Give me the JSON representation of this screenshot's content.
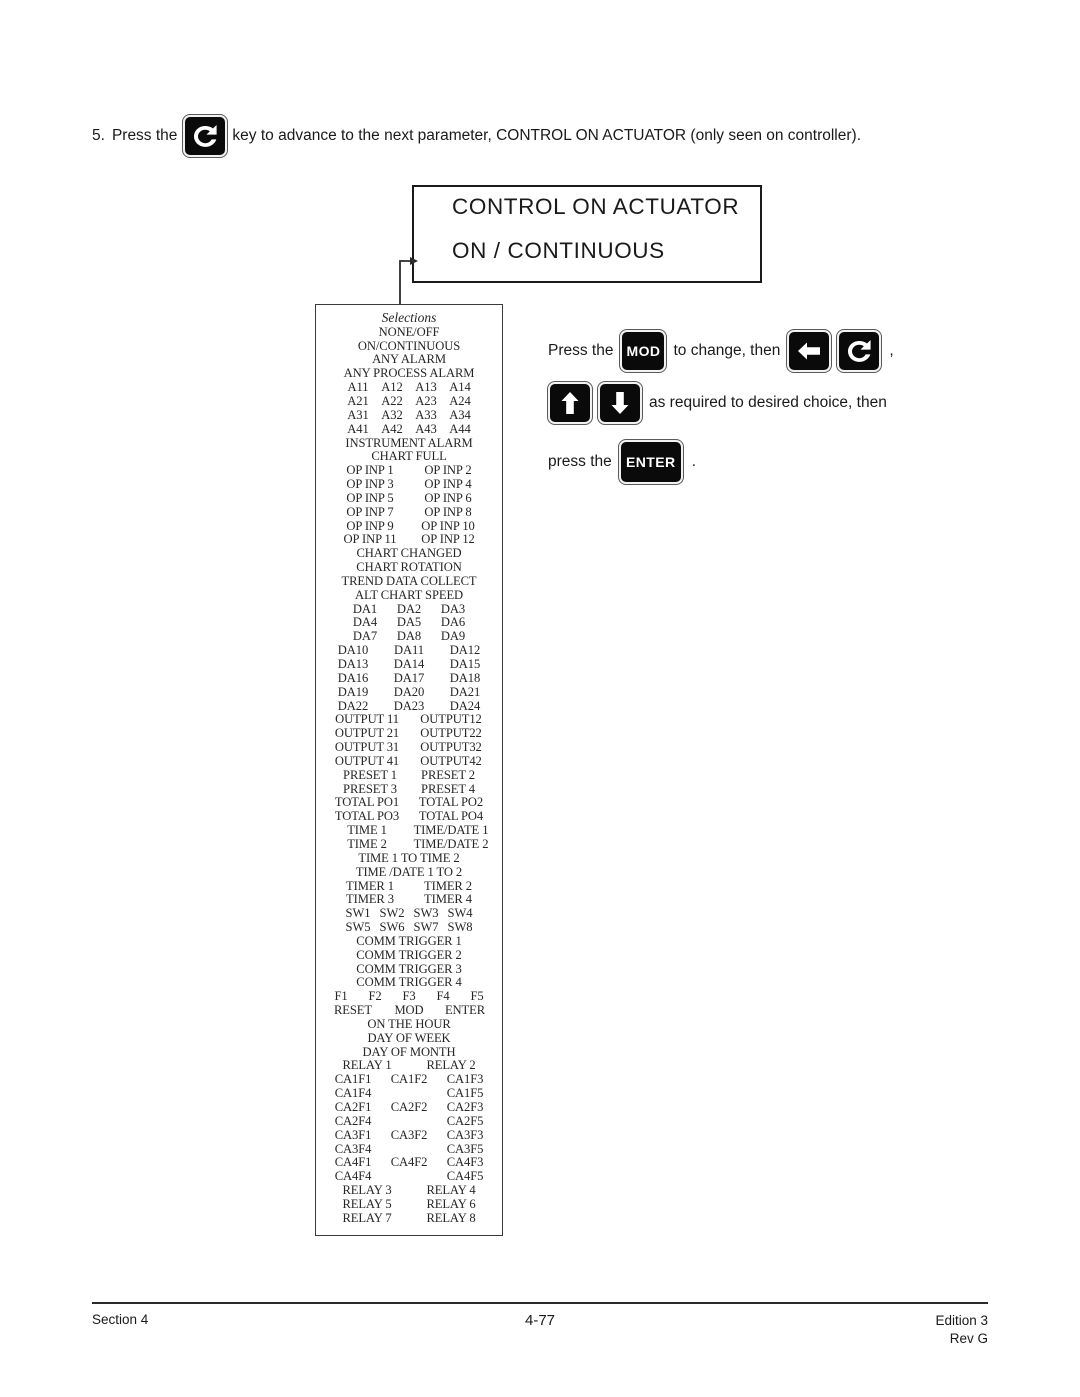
{
  "step": {
    "number": "5.",
    "text_before_key": "Press the",
    "key_icon": "loop-advance-icon",
    "text_after_key": "key to advance to the next parameter, CONTROL ON ACTUATOR  (only seen on controller)."
  },
  "display": {
    "line1": "CONTROL  ON  ACTUATOR",
    "line2": "ON / CONTINUOUS"
  },
  "instructions": {
    "row1": {
      "press_the": "Press the",
      "mod_key": "MOD",
      "to_change": "to change, then",
      "left_key_icon": "left-arrow-icon",
      "loop_key_icon": "loop-advance-icon",
      "comma": ","
    },
    "row2": {
      "up_key_icon": "up-arrow-icon",
      "down_key_icon": "down-arrow-icon",
      "text": "as required to desired choice, then"
    },
    "row3": {
      "press_the": "press  the",
      "enter_key": "ENTER",
      "period": "."
    }
  },
  "selections": {
    "title": "Selections",
    "rows": [
      {
        "cols": [
          "NONE/OFF"
        ]
      },
      {
        "cols": [
          "ON/CONTINUOUS"
        ]
      },
      {
        "cols": [
          "ANY ALARM"
        ]
      },
      {
        "cols": [
          "ANY PROCESS ALARM"
        ]
      },
      {
        "layout": "c4",
        "cols": [
          "A11",
          "A12",
          "A13",
          "A14"
        ]
      },
      {
        "layout": "c4",
        "cols": [
          "A21",
          "A22",
          "A23",
          "A24"
        ]
      },
      {
        "layout": "c4",
        "cols": [
          "A31",
          "A32",
          "A33",
          "A34"
        ]
      },
      {
        "layout": "c4",
        "cols": [
          "A41",
          "A42",
          "A43",
          "A44"
        ]
      },
      {
        "cols": [
          "INSTRUMENT ALARM"
        ]
      },
      {
        "cols": [
          "CHART FULL"
        ]
      },
      {
        "layout": "c2",
        "cols": [
          "OP INP 1",
          "OP INP 2"
        ]
      },
      {
        "layout": "c2",
        "cols": [
          "OP INP 3",
          "OP INP 4"
        ]
      },
      {
        "layout": "c2",
        "cols": [
          "OP INP 5",
          "OP INP 6"
        ]
      },
      {
        "layout": "c2",
        "cols": [
          "OP INP 7",
          "OP INP 8"
        ]
      },
      {
        "layout": "c2",
        "cols": [
          "OP INP 9",
          "OP INP 10"
        ]
      },
      {
        "layout": "c2",
        "cols": [
          "OP INP 11",
          "OP INP 12"
        ]
      },
      {
        "cols": [
          "CHART CHANGED"
        ]
      },
      {
        "cols": [
          "CHART  ROTATION"
        ]
      },
      {
        "cols": [
          "TREND DATA COLLECT"
        ]
      },
      {
        "cols": [
          "ALT CHART SPEED"
        ]
      },
      {
        "layout": "c3",
        "cols": [
          "DA1",
          "DA2",
          "DA3"
        ]
      },
      {
        "layout": "c3",
        "cols": [
          "DA4",
          "DA5",
          "DA6"
        ]
      },
      {
        "layout": "c3",
        "cols": [
          "DA7",
          "DA8",
          "DA9"
        ]
      },
      {
        "layout": "c3w",
        "cols": [
          "DA10",
          "DA11",
          "DA12"
        ]
      },
      {
        "layout": "c3w",
        "cols": [
          "DA13",
          "DA14",
          "DA15"
        ]
      },
      {
        "layout": "c3w",
        "cols": [
          "DA16",
          "DA17",
          "DA18"
        ]
      },
      {
        "layout": "c3w",
        "cols": [
          "DA19",
          "DA20",
          "DA21"
        ]
      },
      {
        "layout": "c3w",
        "cols": [
          "DA22",
          "DA23",
          "DA24"
        ]
      },
      {
        "layout": "c2w",
        "cols": [
          "OUTPUT 11",
          "OUTPUT12"
        ]
      },
      {
        "layout": "c2w",
        "cols": [
          "OUTPUT 21",
          "OUTPUT22"
        ]
      },
      {
        "layout": "c2w",
        "cols": [
          "OUTPUT 31",
          "OUTPUT32"
        ]
      },
      {
        "layout": "c2w",
        "cols": [
          "OUTPUT 41",
          "OUTPUT42"
        ]
      },
      {
        "layout": "c2",
        "cols": [
          "PRESET 1",
          "PRESET 2"
        ]
      },
      {
        "layout": "c2",
        "cols": [
          "PRESET 3",
          "PRESET 4"
        ]
      },
      {
        "layout": "c2w",
        "cols": [
          "TOTAL PO1",
          "TOTAL PO2"
        ]
      },
      {
        "layout": "c2w",
        "cols": [
          "TOTAL PO3",
          "TOTAL PO4"
        ]
      },
      {
        "layout": "c2w",
        "cols": [
          "TIME 1",
          "TIME/DATE 1"
        ]
      },
      {
        "layout": "c2w",
        "cols": [
          "TIME 2",
          "TIME/DATE 2"
        ]
      },
      {
        "cols": [
          "TIME 1 TO TIME 2"
        ]
      },
      {
        "cols": [
          "TIME /DATE 1 TO 2"
        ]
      },
      {
        "layout": "c2",
        "cols": [
          "TIMER 1",
          "TIMER 2"
        ]
      },
      {
        "layout": "c2",
        "cols": [
          "TIMER 3",
          "TIMER 4"
        ]
      },
      {
        "layout": "c4",
        "cols": [
          "SW1",
          "SW2",
          "SW3",
          "SW4"
        ]
      },
      {
        "layout": "c4",
        "cols": [
          "SW5",
          "SW6",
          "SW7",
          "SW8"
        ]
      },
      {
        "cols": [
          "COMM TRIGGER 1"
        ]
      },
      {
        "cols": [
          "COMM TRIGGER 2"
        ]
      },
      {
        "cols": [
          "COMM TRIGGER 3"
        ]
      },
      {
        "cols": [
          "COMM TRIGGER 4"
        ]
      },
      {
        "layout": "c4",
        "cols": [
          "F1",
          "F2",
          "F3",
          "F4",
          "F5"
        ]
      },
      {
        "layout": "c3w",
        "cols": [
          "RESET",
          "MOD",
          "ENTER"
        ]
      },
      {
        "cols": [
          "ON THE HOUR"
        ]
      },
      {
        "cols": [
          "DAY OF WEEK"
        ]
      },
      {
        "cols": [
          "DAY OF MONTH"
        ]
      },
      {
        "layout": "c2w",
        "cols": [
          "RELAY 1",
          "RELAY 2"
        ]
      },
      {
        "layout": "ca3",
        "cols": [
          "CA1F1",
          "CA1F2",
          "CA1F3"
        ]
      },
      {
        "layout": "ca2",
        "cols": [
          "CA1F4",
          "CA1F5"
        ]
      },
      {
        "layout": "ca3",
        "cols": [
          "CA2F1",
          "CA2F2",
          "CA2F3"
        ]
      },
      {
        "layout": "ca2",
        "cols": [
          "CA2F4",
          "CA2F5"
        ]
      },
      {
        "layout": "ca3",
        "cols": [
          "CA3F1",
          "CA3F2",
          "CA3F3"
        ]
      },
      {
        "layout": "ca2",
        "cols": [
          "CA3F4",
          "CA3F5"
        ]
      },
      {
        "layout": "ca3",
        "cols": [
          "CA4F1",
          "CA4F2",
          "CA4F3"
        ]
      },
      {
        "layout": "ca2",
        "cols": [
          "CA4F4",
          "CA4F5"
        ]
      },
      {
        "layout": "c2w",
        "cols": [
          "RELAY 3",
          "RELAY 4"
        ]
      },
      {
        "layout": "c2w",
        "cols": [
          "RELAY 5",
          "RELAY 6"
        ]
      },
      {
        "layout": "c2w",
        "cols": [
          "RELAY 7",
          "RELAY 8"
        ]
      }
    ]
  },
  "footer": {
    "section": "Section  4",
    "page": "4-77",
    "edition": "Edition 3",
    "revision": "Rev G"
  }
}
